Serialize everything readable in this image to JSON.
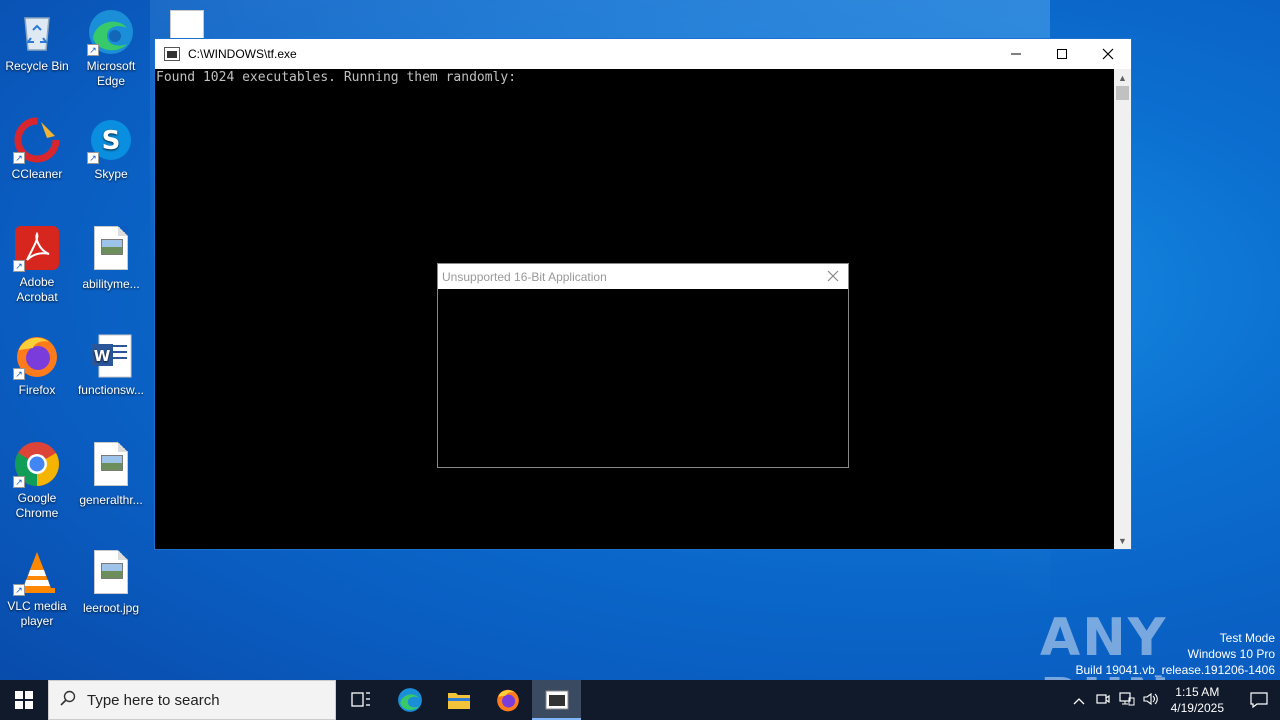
{
  "desktop": {
    "icons": [
      {
        "label": "Recycle Bin",
        "icon": "recycle-bin-icon"
      },
      {
        "label": "Microsoft Edge",
        "icon": "edge-icon"
      },
      {
        "label": "CCleaner",
        "icon": "ccleaner-icon"
      },
      {
        "label": "Skype",
        "icon": "skype-icon"
      },
      {
        "label": "Adobe Acrobat",
        "icon": "acrobat-icon"
      },
      {
        "label": "abilityme...",
        "icon": "image-file-icon"
      },
      {
        "label": "Firefox",
        "icon": "firefox-icon"
      },
      {
        "label": "functionsw...",
        "icon": "word-doc-icon"
      },
      {
        "label": "Google Chrome",
        "icon": "chrome-icon"
      },
      {
        "label": "generalthr...",
        "icon": "image-file-icon"
      },
      {
        "label": "VLC media player",
        "icon": "vlc-icon"
      },
      {
        "label": "leeroot.jpg",
        "icon": "image-file-icon"
      }
    ]
  },
  "console": {
    "title": "C:\\WINDOWS\\tf.exe",
    "output": "Found 1024 executables. Running them randomly:"
  },
  "dialog": {
    "title": "Unsupported 16-Bit Application"
  },
  "watermark": {
    "brand": "ANY RUN",
    "line1": "Test Mode",
    "line2": "Windows 10 Pro",
    "line3": "Build 19041.vb_release.191206-1406"
  },
  "taskbar": {
    "search_placeholder": "Type here to search",
    "time": "1:15 AM",
    "date": "4/19/2025"
  },
  "colors": {
    "accent": "#0b6fd0",
    "taskbar": "#101a2a"
  }
}
